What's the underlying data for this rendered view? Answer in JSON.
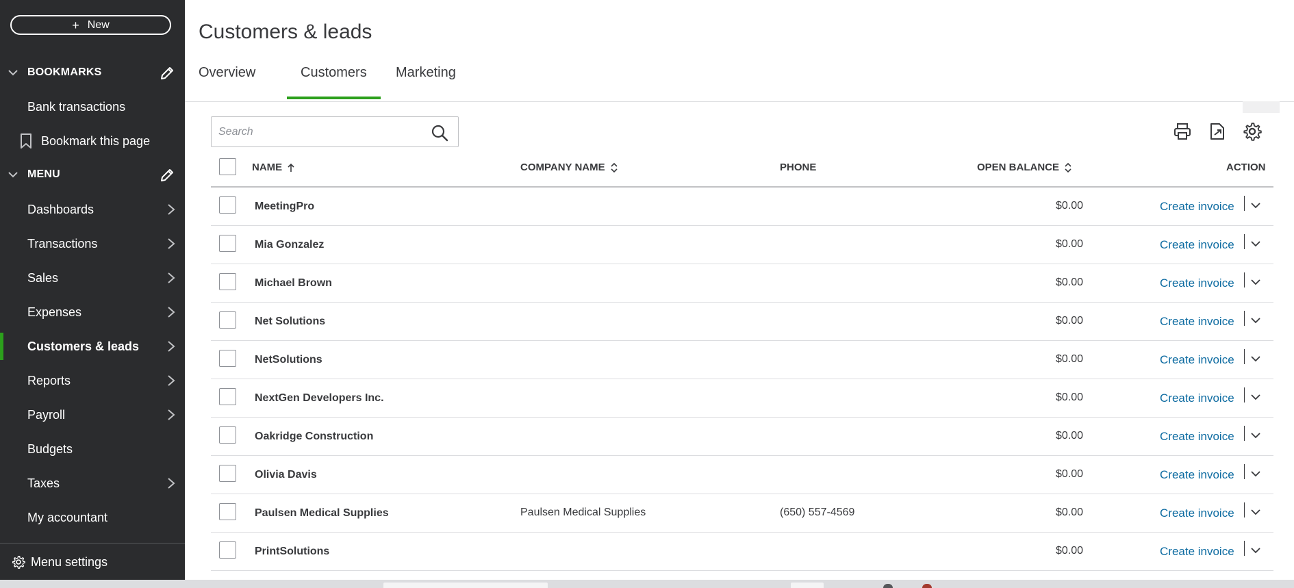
{
  "sidebar": {
    "new_label": "New",
    "bookmarks_title": "BOOKMARKS",
    "bookmarks": [
      {
        "label": "Bank transactions"
      },
      {
        "label": "Bookmark this page"
      }
    ],
    "menu_title": "MENU",
    "menu_items": [
      {
        "label": "Dashboards",
        "has_arrow": true
      },
      {
        "label": "Transactions",
        "has_arrow": true
      },
      {
        "label": "Sales",
        "has_arrow": true
      },
      {
        "label": "Expenses",
        "has_arrow": true
      },
      {
        "label": "Customers & leads",
        "has_arrow": true,
        "active": true
      },
      {
        "label": "Reports",
        "has_arrow": true
      },
      {
        "label": "Payroll",
        "has_arrow": true
      },
      {
        "label": "Budgets",
        "has_arrow": false
      },
      {
        "label": "Taxes",
        "has_arrow": true
      },
      {
        "label": "My accountant",
        "has_arrow": false
      }
    ],
    "menu_settings_label": "Menu settings"
  },
  "page": {
    "title": "Customers & leads",
    "tabs": [
      {
        "label": "Overview"
      },
      {
        "label": "Customers",
        "active": true
      },
      {
        "label": "Marketing"
      }
    ]
  },
  "search": {
    "placeholder": "Search",
    "value": ""
  },
  "table": {
    "columns": {
      "name": "NAME",
      "company": "COMPANY NAME",
      "phone": "PHONE",
      "balance": "OPEN BALANCE",
      "action": "ACTION"
    },
    "action_label": "Create invoice",
    "rows": [
      {
        "name": "MeetingPro",
        "company": "",
        "phone": "",
        "balance": "$0.00"
      },
      {
        "name": "Mia Gonzalez",
        "company": "",
        "phone": "",
        "balance": "$0.00"
      },
      {
        "name": "Michael Brown",
        "company": "",
        "phone": "",
        "balance": "$0.00"
      },
      {
        "name": "Net Solutions",
        "company": "",
        "phone": "",
        "balance": "$0.00"
      },
      {
        "name": "NetSolutions",
        "company": "",
        "phone": "",
        "balance": "$0.00"
      },
      {
        "name": "NextGen Developers Inc.",
        "company": "",
        "phone": "",
        "balance": "$0.00"
      },
      {
        "name": "Oakridge Construction",
        "company": "",
        "phone": "",
        "balance": "$0.00"
      },
      {
        "name": "Olivia Davis",
        "company": "",
        "phone": "",
        "balance": "$0.00"
      },
      {
        "name": "Paulsen Medical Supplies",
        "company": "Paulsen Medical Supplies",
        "phone": "(650) 557-4569",
        "balance": "$0.00"
      },
      {
        "name": "PrintSolutions",
        "company": "",
        "phone": "",
        "balance": "$0.00"
      }
    ]
  },
  "colors": {
    "sidebar_bg": "#2b2c2e",
    "accent_green": "#2ca01c",
    "link_blue": "#0d6ba1",
    "text": "#393a3d"
  }
}
